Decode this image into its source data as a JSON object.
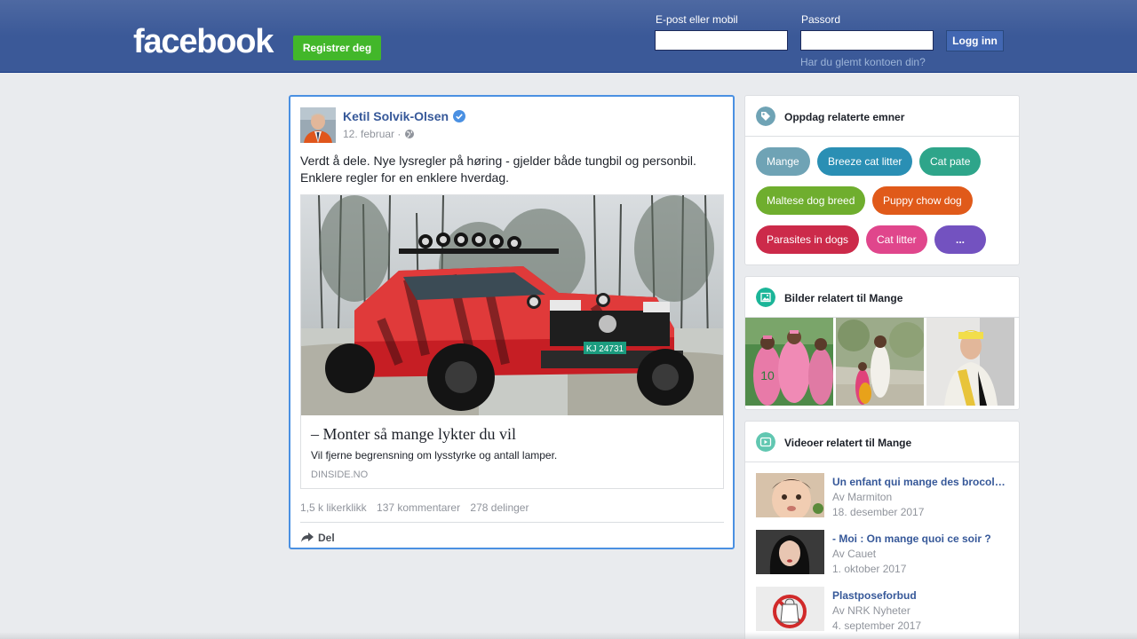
{
  "header": {
    "logo": "facebook",
    "register_label": "Registrer deg",
    "email_label": "E-post eller mobil",
    "password_label": "Passord",
    "login_label": "Logg inn",
    "forgot_label": "Har du glemt kontoen din?"
  },
  "post": {
    "author": "Ketil Solvik-Olsen",
    "date": "12. februar ·",
    "text": "Verdt å dele. Nye lysregler på høring - gjelder både tungbil og personbil. Enklere regler for en enklere hverdag.",
    "link": {
      "title": "– Monter så mange lykter du vil",
      "description": "Vil fjerne begrensning om lysstyrke og antall lamper.",
      "domain": "DINSIDE.NO",
      "plate": "KJ 24731"
    },
    "stats": {
      "likes": "1,5 k likerklikk",
      "comments": "137 kommentarer",
      "shares": "278 delinger"
    },
    "share_label": "Del"
  },
  "related_topics": {
    "title": "Oppdag relaterte emner",
    "topics": [
      {
        "label": "Mange",
        "color": "#6fa3b5"
      },
      {
        "label": "Breeze cat litter",
        "color": "#2a8fb4"
      },
      {
        "label": "Cat pate",
        "color": "#2ea58a"
      },
      {
        "label": "Maltese dog breed",
        "color": "#6fae2e"
      },
      {
        "label": "Puppy chow dog",
        "color": "#e05a1a"
      },
      {
        "label": "Parasites in dogs",
        "color": "#cc2a4a"
      },
      {
        "label": "Cat litter",
        "color": "#e0468c"
      },
      {
        "label": "...",
        "color": "#7352c0"
      }
    ]
  },
  "related_images": {
    "title": "Bilder relatert til Mange"
  },
  "related_videos": {
    "title": "Videoer relatert til Mange",
    "videos": [
      {
        "title": "Un enfant qui mange des brocolis ...",
        "source": "Av Marmiton",
        "date": "18. desember 2017"
      },
      {
        "title": "- Moi : On mange quoi ce soir ?",
        "source": "Av Cauet",
        "date": "1. oktober 2017"
      },
      {
        "title": "Plastposeforbud",
        "source": "Av NRK Nyheter",
        "date": "4. september 2017"
      }
    ]
  }
}
